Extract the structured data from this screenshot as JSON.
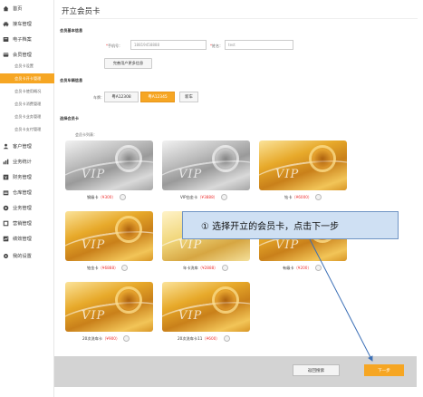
{
  "sidebar": {
    "items": [
      {
        "label": "首页",
        "icon": "home-icon"
      },
      {
        "label": "接车管理",
        "icon": "car-icon"
      },
      {
        "label": "电子档案",
        "icon": "archive-icon"
      },
      {
        "label": "会员管理",
        "icon": "member-icon"
      },
      {
        "label": "客户管理",
        "icon": "customer-icon"
      },
      {
        "label": "业务统计",
        "icon": "stats-icon"
      },
      {
        "label": "财务管理",
        "icon": "finance-icon"
      },
      {
        "label": "仓库管理",
        "icon": "warehouse-icon"
      },
      {
        "label": "业务管理",
        "icon": "business-icon"
      },
      {
        "label": "营销管理",
        "icon": "marketing-icon"
      },
      {
        "label": "绩效管理",
        "icon": "performance-icon"
      },
      {
        "label": "我的设置",
        "icon": "gear-icon"
      }
    ],
    "subitems": [
      {
        "label": "会员卡设置",
        "active": false
      },
      {
        "label": "会员卡开卡管理",
        "active": true
      },
      {
        "label": "会员卡使用概况",
        "active": false
      },
      {
        "label": "会员卡消费管理",
        "active": false
      },
      {
        "label": "会员卡业务管理",
        "active": false
      },
      {
        "label": "会员卡支付管理",
        "active": false
      }
    ]
  },
  "page": {
    "title": "开立会员卡",
    "section_basic": "会员基本信息",
    "phone_label": "手机号：",
    "phone_value": "18819458888",
    "name_label": "姓名：",
    "name_placeholder": "test",
    "more_info_btn": "完善用户更多信息",
    "section_vehicle": "会员车辆信息",
    "plate_label": "车牌：",
    "plates": [
      {
        "label": "粤A12308",
        "active": false
      },
      {
        "label": "粤A12345",
        "active": true
      },
      {
        "label": "新车",
        "active": false
      }
    ],
    "section_card": "选择会员卡",
    "card_list_label": "会员卡列表："
  },
  "cards": [
    {
      "name": "钢级卡",
      "price": "¥300",
      "style": "silver"
    },
    {
      "name": "VIP白金卡",
      "price": "¥3888",
      "style": "silver"
    },
    {
      "name": "钻卡",
      "price": "¥6000",
      "style": "gold"
    },
    {
      "name": "铂金卡",
      "price": "¥6888",
      "style": "gold"
    },
    {
      "name": "年卡洗车",
      "price": "¥2888",
      "style": "gold2"
    },
    {
      "name": "有级卡",
      "price": "¥200",
      "style": "gold"
    },
    {
      "name": "20次洗车卡",
      "price": "¥900",
      "style": "gold"
    },
    {
      "name": "20次洗车卡11",
      "price": "¥600",
      "style": "gold"
    }
  ],
  "footer": {
    "back_label": "返回搜索",
    "next_label": "下一步"
  },
  "callout": {
    "text": "① 选择开立的会员卡，点击下一步"
  },
  "colors": {
    "accent": "#f6a623",
    "price": "#e33333",
    "callout_bg": "#cfe0f3",
    "callout_border": "#6f94c4"
  }
}
